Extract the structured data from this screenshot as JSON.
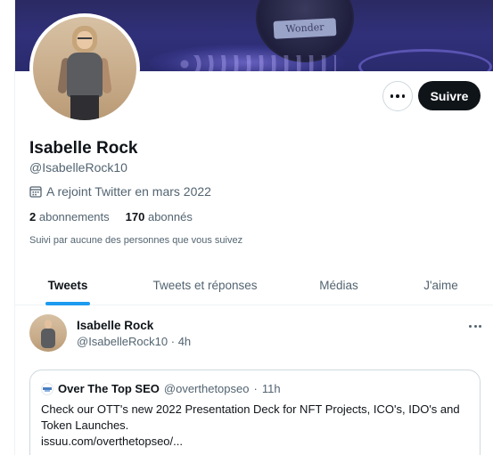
{
  "banner": {
    "plaque_text": "Wonder"
  },
  "profile": {
    "name": "Isabelle Rock",
    "handle": "@IsabelleRock10",
    "joined": "A rejoint Twitter en mars 2022",
    "following_count": "2",
    "following_label": "abonnements",
    "followers_count": "170",
    "followers_label": "abonnés",
    "followed_by": "Suivi par aucune des personnes que vous suivez"
  },
  "actions": {
    "follow_label": "Suivre"
  },
  "tabs": [
    {
      "label": "Tweets",
      "active": true
    },
    {
      "label": "Tweets et réponses",
      "active": false
    },
    {
      "label": "Médias",
      "active": false
    },
    {
      "label": "J'aime",
      "active": false
    }
  ],
  "tweet": {
    "author_name": "Isabelle Rock",
    "author_handle": "@IsabelleRock10",
    "separator": "·",
    "time": "4h",
    "quote": {
      "name": "Over The Top SEO",
      "handle": "@overthetopseo",
      "separator": "·",
      "time": "11h",
      "text": "Check our OTT's new 2022 Presentation Deck for NFT Projects, ICO's, IDO's and Token Launches.",
      "link": "issuu.com/overthetopseo/..."
    }
  },
  "colors": {
    "accent": "#1d9bf0",
    "text_primary": "#0f1419",
    "text_secondary": "#536471",
    "follow_button_bg": "#0f1419"
  },
  "icons": {
    "more": "more-horizontal-icon",
    "calendar": "calendar-icon"
  }
}
